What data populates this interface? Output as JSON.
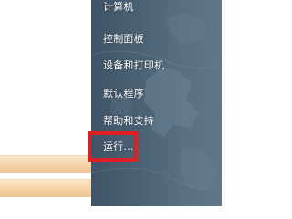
{
  "start_menu": {
    "right_items": [
      {
        "label": "计算机"
      },
      {
        "label": "控制面板"
      },
      {
        "label": "设备和打印机"
      },
      {
        "label": "默认程序"
      },
      {
        "label": "帮助和支持"
      },
      {
        "label": "运行..."
      }
    ],
    "highlight": {
      "target": "运行...",
      "color": "#e02020"
    }
  },
  "colors": {
    "right_pane": "#4a6174",
    "left_strip": "#f6d2a6",
    "text": "#ffffff"
  }
}
